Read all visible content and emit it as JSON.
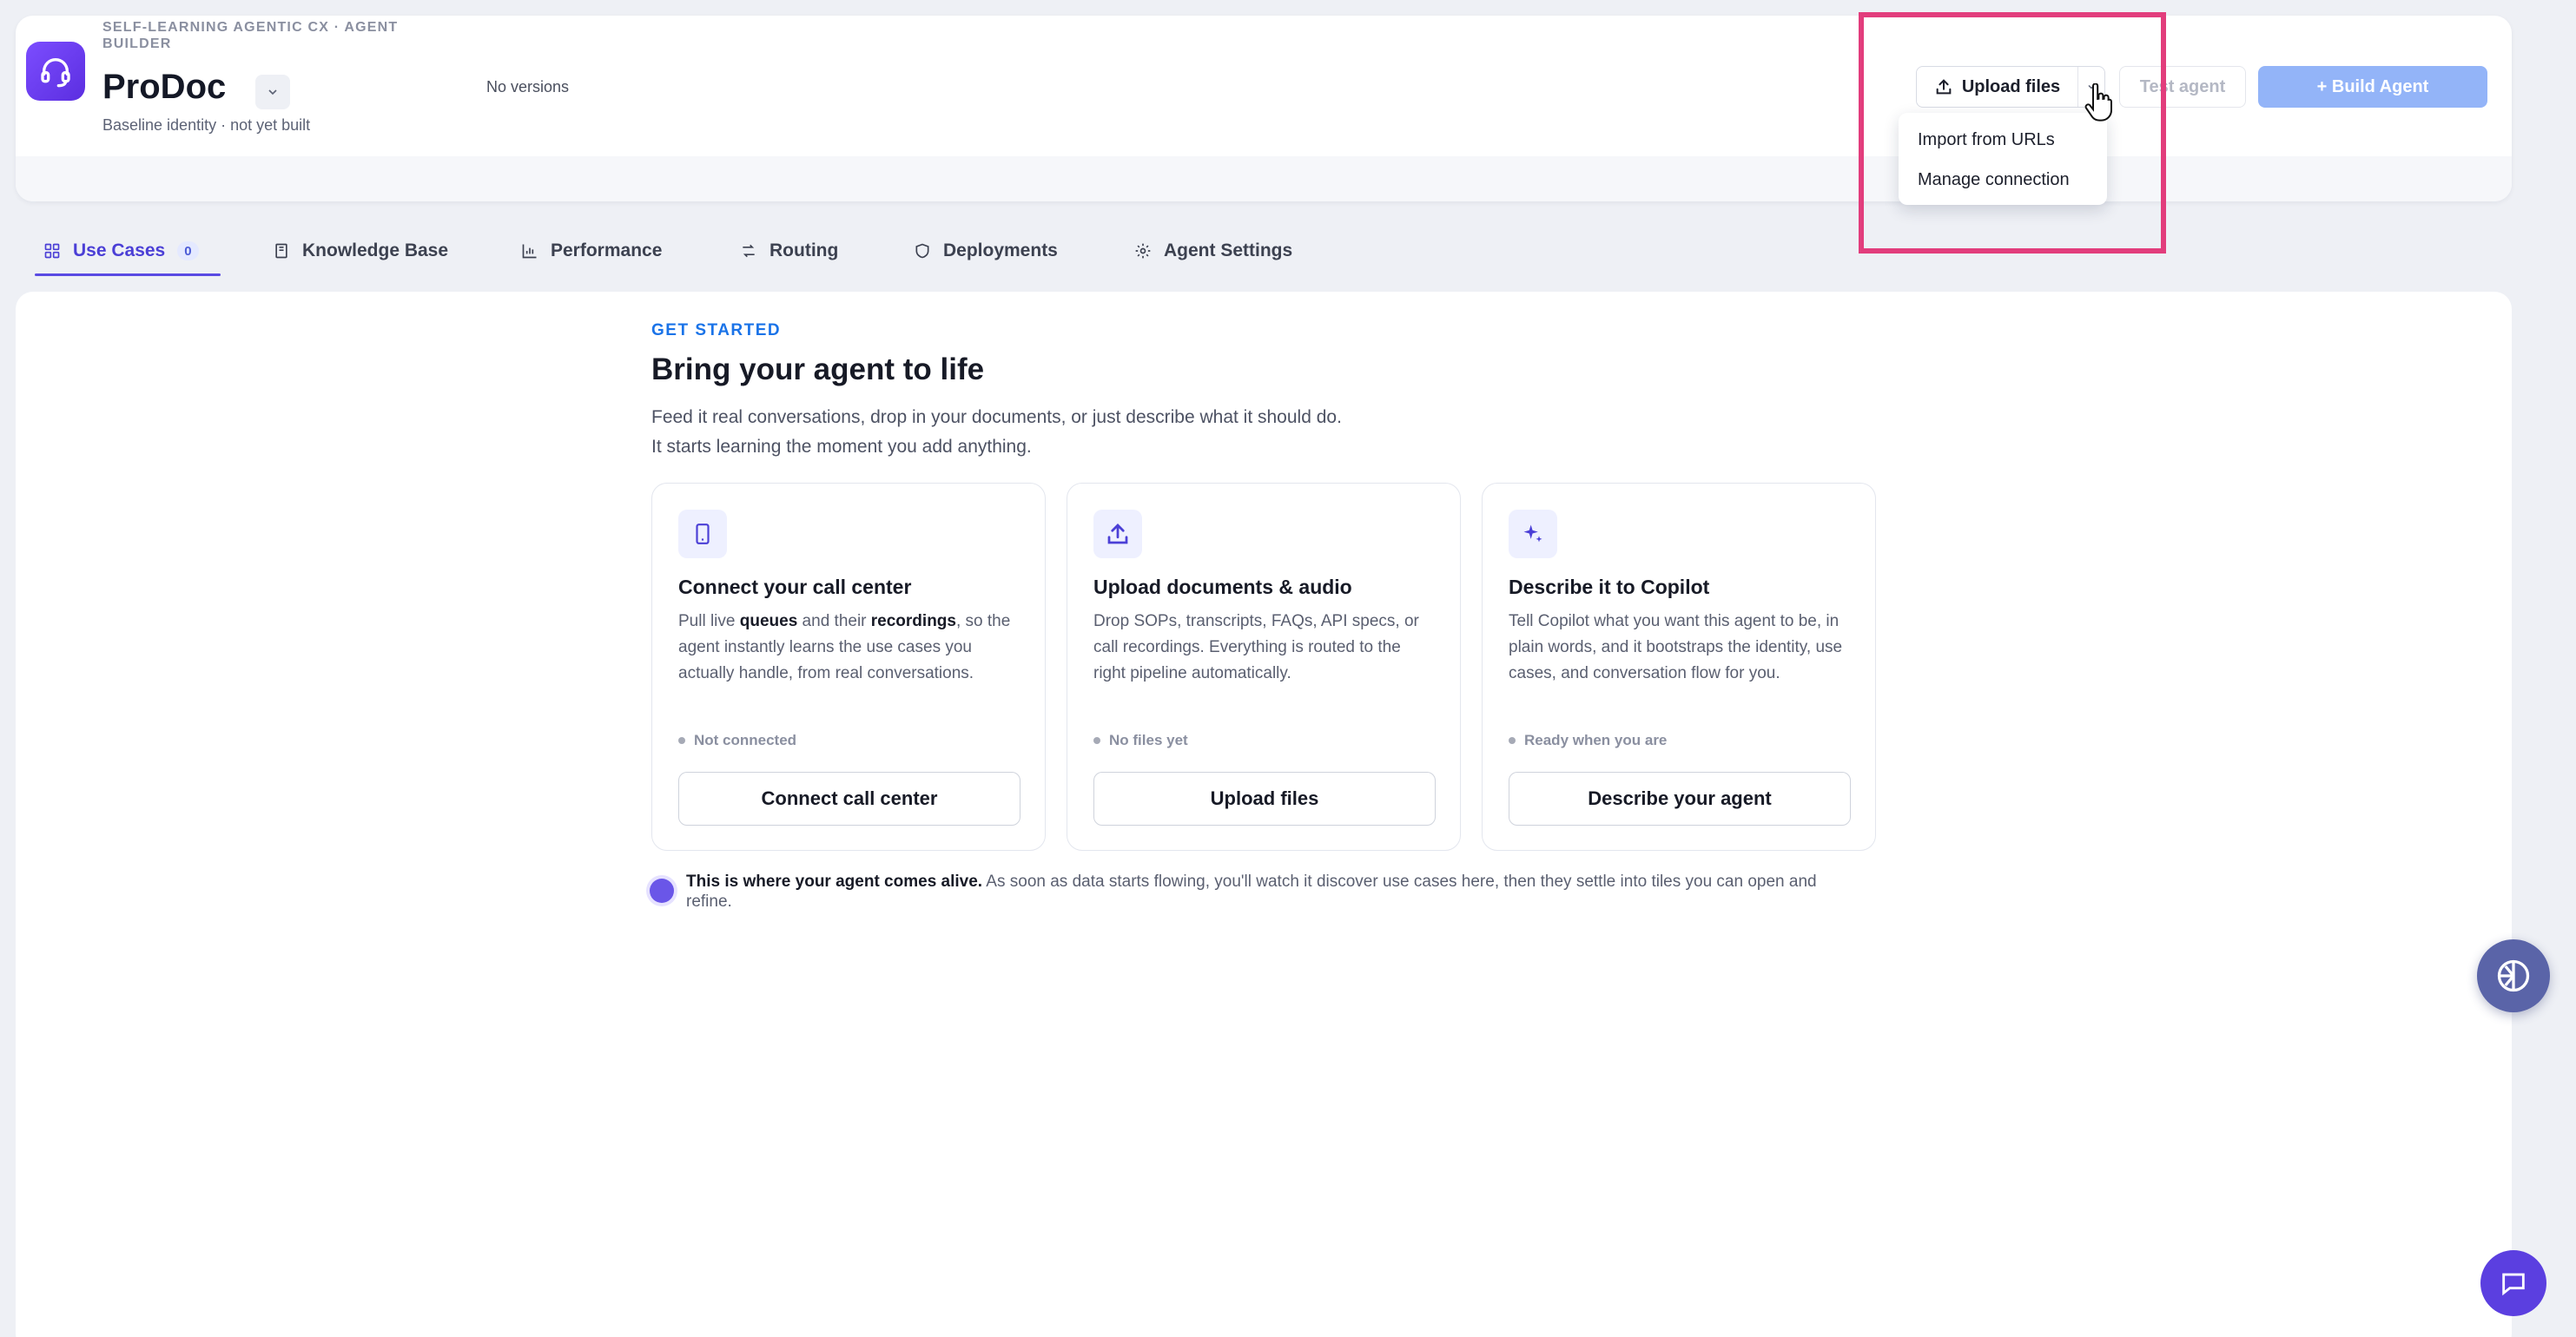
{
  "header": {
    "breadcrumb": "SELF-LEARNING AGENTIC CX · AGENT BUILDER",
    "agent_name": "ProDoc",
    "agent_status": "Baseline identity · not yet built",
    "versions": "No versions",
    "upload_label": "Upload files",
    "test_label": "Test agent",
    "build_label": "+ Build Agent",
    "colors": {
      "accent": "#5a4ae3",
      "build": "#93b4f8",
      "highlight": "#e23d7c"
    }
  },
  "upload_menu": {
    "items": [
      "Import from URLs",
      "Manage connection"
    ]
  },
  "tabs": [
    {
      "label": "Use Cases",
      "count": "0",
      "icon": "grid-icon"
    },
    {
      "label": "Knowledge Base",
      "icon": "book-icon"
    },
    {
      "label": "Performance",
      "icon": "bar-chart-icon"
    },
    {
      "label": "Routing",
      "icon": "routing-icon"
    },
    {
      "label": "Deployments",
      "icon": "shield-icon"
    },
    {
      "label": "Agent Settings",
      "icon": "gear-icon"
    }
  ],
  "main": {
    "eyebrow": "GET STARTED",
    "headline": "Bring your agent to life",
    "subtext_line1": "Feed it real conversations, drop in your documents, or just describe what it should do.",
    "subtext_line2": "It starts learning the moment you add anything.",
    "cards": [
      {
        "title": "Connect your call center",
        "desc_a": "Pull live ",
        "desc_b": "queues",
        "desc_c": " and their ",
        "desc_d": "recordings",
        "desc_e": ", so the agent instantly learns the use cases you actually handle, from real conversations.",
        "status": "Not connected",
        "button": "Connect call center",
        "icon": "phone-icon"
      },
      {
        "title": "Upload documents & audio",
        "desc": "Drop SOPs, transcripts, FAQs, API specs, or call recordings. Everything is routed to the right pipeline automatically.",
        "status": "No files yet",
        "button": "Upload files",
        "icon": "upload-icon"
      },
      {
        "title": "Describe it to Copilot",
        "desc": "Tell Copilot what you want this agent to be, in plain words, and it bootstraps the identity, use cases, and conversation flow for you.",
        "status": "Ready when you are",
        "button": "Describe your agent",
        "icon": "sparkle-icon"
      }
    ],
    "alive_bold": "This is where your agent comes alive.",
    "alive_text": " As soon as data starts flowing, you'll watch it discover use cases here, then they settle into tiles you can open and refine."
  }
}
